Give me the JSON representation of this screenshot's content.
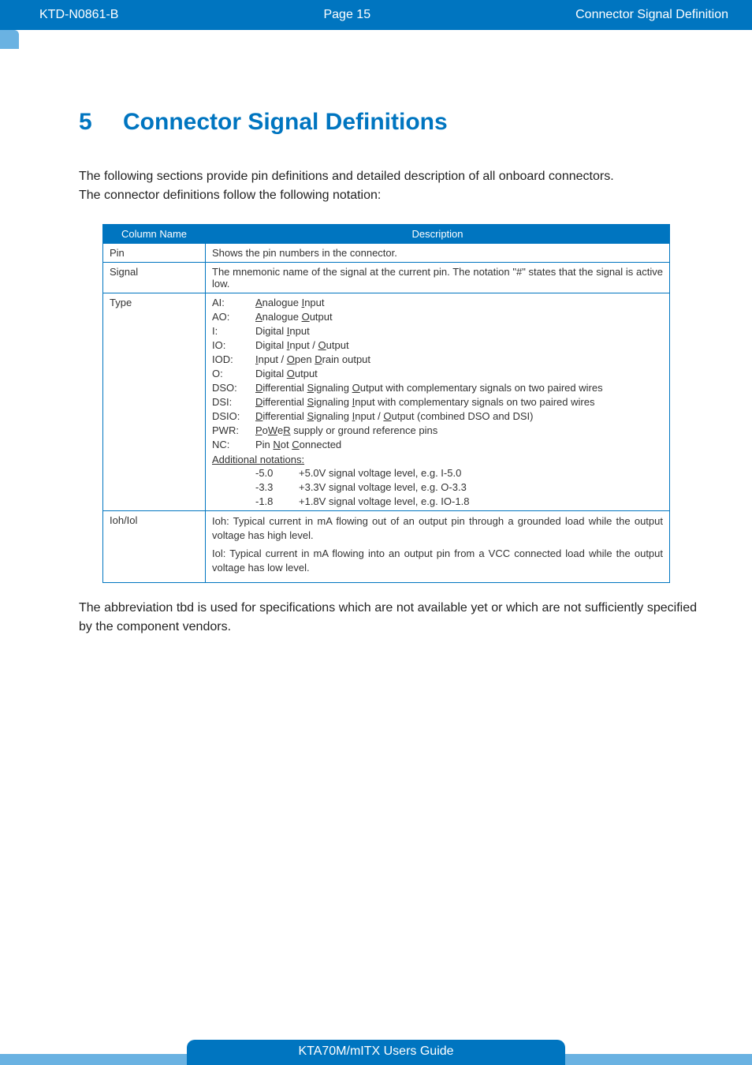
{
  "header": {
    "left": "KTD-N0861-B",
    "center": "Page 15",
    "right": "Connector Signal Definition"
  },
  "section": {
    "number": "5",
    "title": "Connector Signal Definitions"
  },
  "intro_line1": "The following sections provide pin definitions and detailed description of all onboard connectors.",
  "intro_line2": "The connector definitions follow the following notation:",
  "table": {
    "head_col": "Column Name",
    "head_desc": "Description",
    "rows": {
      "pin": {
        "name": "Pin",
        "desc": "Shows the pin numbers in the connector."
      },
      "signal": {
        "name": "Signal",
        "desc": "The mnemonic name of the signal at the current pin. The notation \"#\" states that the signal is active low."
      },
      "type": {
        "name": "Type",
        "items": [
          {
            "k": "AI:",
            "a": "A",
            "mid": "nalogue ",
            "b": "I",
            "post": "nput"
          },
          {
            "k": "AO:",
            "a": "A",
            "mid": "nalogue ",
            "b": "O",
            "post": "utput"
          },
          {
            "k": "I:",
            "a": "",
            "mid": "Digital ",
            "b": "I",
            "post": "nput"
          },
          {
            "k": "IO:",
            "a": "",
            "mid": "Digital ",
            "b": "I",
            "post": "nput / ",
            "c": "O",
            "post2": "utput"
          },
          {
            "k": "IOD:",
            "a": "I",
            "mid": "nput / ",
            "b": "O",
            "post": "pen ",
            "c": "D",
            "post2": "rain output"
          },
          {
            "k": "O:",
            "a": "",
            "mid": "Digital ",
            "b": "O",
            "post": "utput"
          },
          {
            "k": "DSO:",
            "a": "D",
            "mid": "ifferential ",
            "b": "S",
            "post": "ignaling ",
            "c": "O",
            "post2": "utput with complementary signals on two paired wires"
          },
          {
            "k": "DSI:",
            "a": "D",
            "mid": "ifferential ",
            "b": "S",
            "post": "ignaling ",
            "c": "I",
            "post2": "nput with complementary signals on two paired wires"
          },
          {
            "k": "DSIO:",
            "a": "D",
            "mid": "ifferential ",
            "b": "S",
            "post": "ignaling ",
            "c": "I",
            "post2": "nput / ",
            "d": "O",
            "post3": "utput (combined DSO and DSI)"
          },
          {
            "k": "PWR:",
            "raw": "PoWeR supply or ground reference pins",
            "uidx": [
              0,
              2,
              4
            ]
          },
          {
            "k": "NC:",
            "a": "",
            "mid": "Pin ",
            "b": "N",
            "post": "ot ",
            "c": "C",
            "post2": "onnected"
          }
        ],
        "additional_label": "Additional notations:",
        "voltages": [
          {
            "v": "-5.0",
            "d": "+5.0V signal voltage level, e.g. I-5.0"
          },
          {
            "v": "-3.3",
            "d": "+3.3V signal voltage level, e.g. O-3.3"
          },
          {
            "v": "-1.8",
            "d": "+1.8V signal voltage level, e.g. IO-1.8"
          }
        ]
      },
      "ioh": {
        "name": "Ioh/Iol",
        "p1": "Ioh: Typical current in mA flowing out of an output pin through a grounded load while the output voltage has high level.",
        "p2": "Iol: Typical current in mA flowing into an output pin from a VCC connected load while the output voltage has low level."
      }
    }
  },
  "abbr": "The abbreviation tbd is used for specifications which are not available yet or which are not sufficiently specified by the component vendors.",
  "footer": "KTA70M/mITX Users Guide"
}
